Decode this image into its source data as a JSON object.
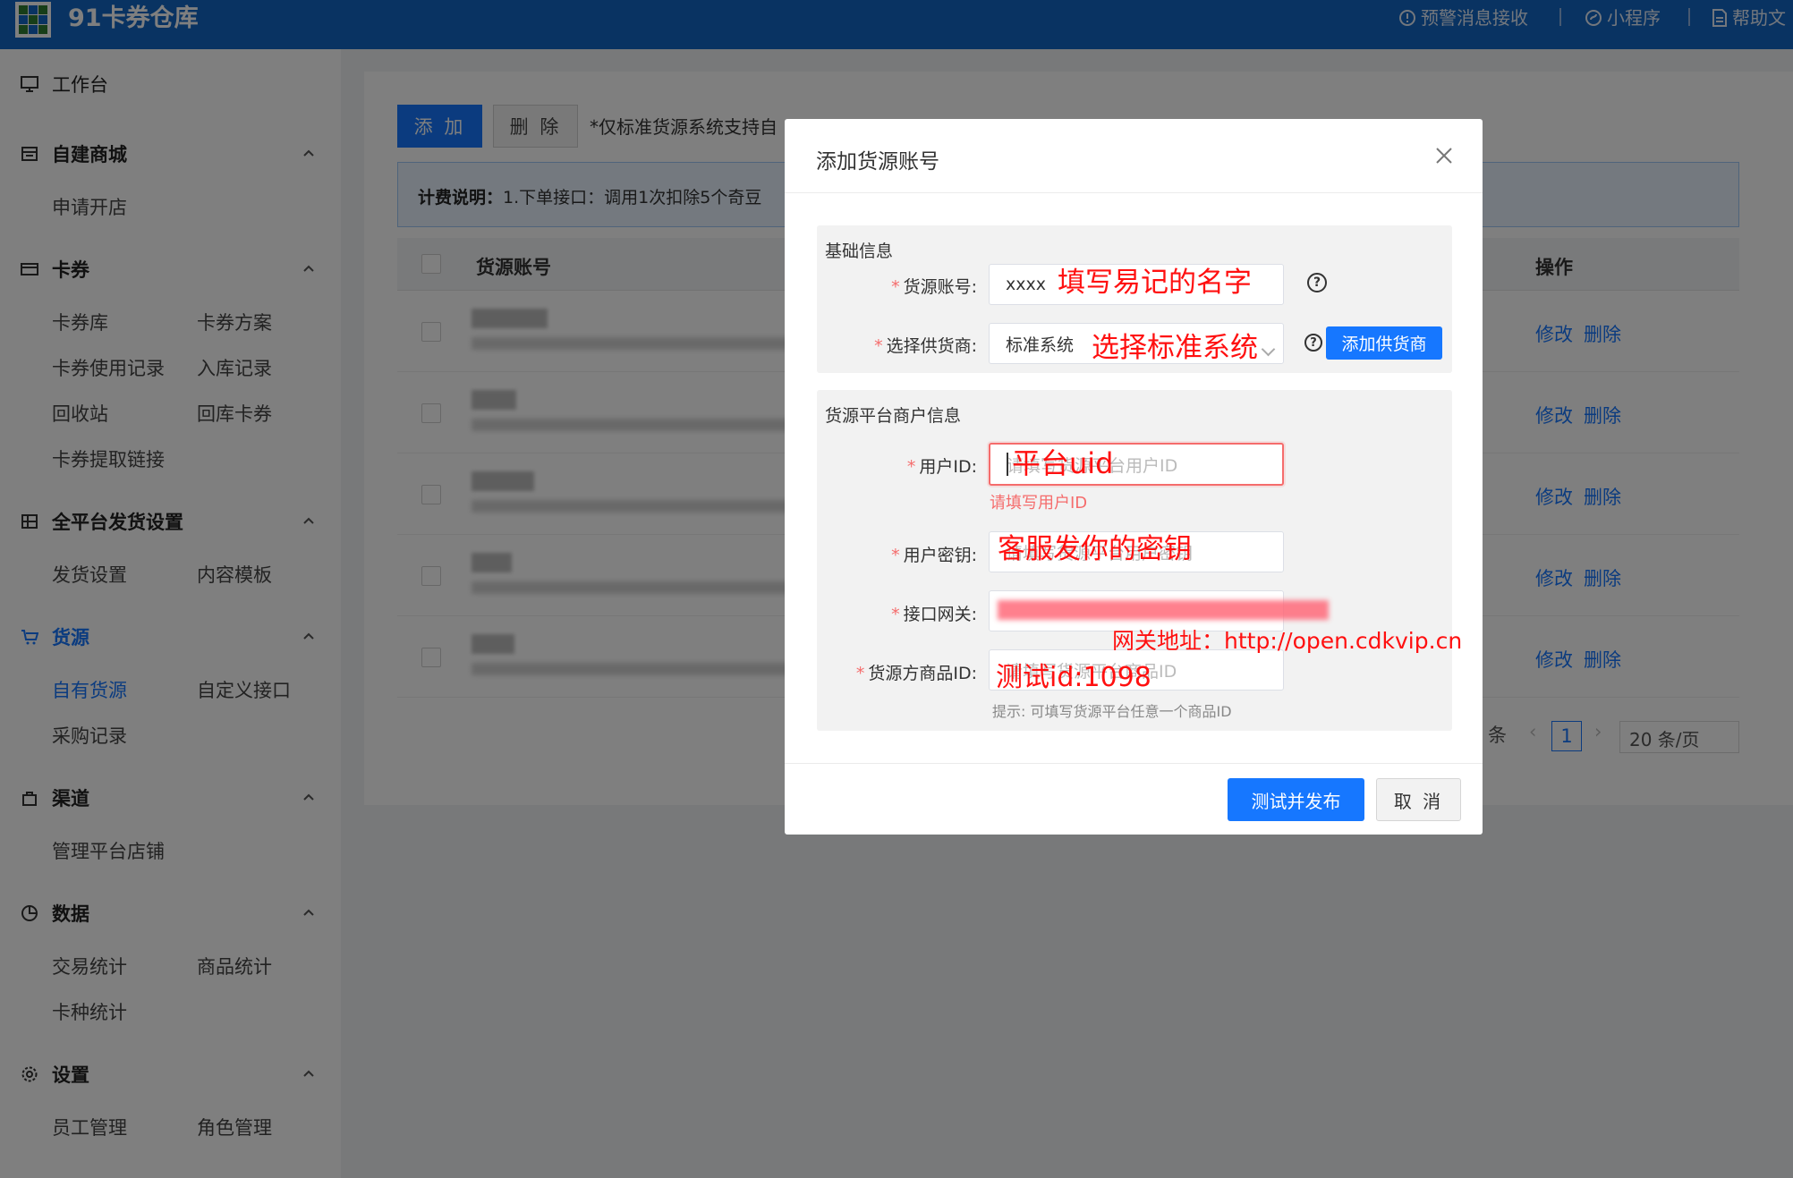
{
  "header": {
    "app_title": "91卡券仓库",
    "links": [
      {
        "icon": "alert-icon",
        "label": "预警消息接收"
      },
      {
        "icon": "miniprogram-icon",
        "label": "小程序"
      },
      {
        "icon": "document-icon",
        "label": "帮助文"
      }
    ]
  },
  "sidebar": {
    "workbench": "工作台",
    "sections": [
      {
        "icon": "store-icon",
        "label": "自建商城",
        "items": [
          "申请开店"
        ]
      },
      {
        "icon": "card-icon",
        "label": "卡券",
        "items": [
          "卡券库",
          "卡券方案",
          "卡券使用记录",
          "入库记录",
          "回收站",
          "回库卡券",
          "卡券提取链接"
        ]
      },
      {
        "icon": "grid-icon",
        "label": "全平台发货设置",
        "items": [
          "发货设置",
          "内容模板"
        ]
      },
      {
        "icon": "cart-icon",
        "label": "货源",
        "items": [
          "自有货源",
          "自定义接口",
          "采购记录"
        ]
      },
      {
        "icon": "bag-icon",
        "label": "渠道",
        "items": [
          "管理平台店铺"
        ]
      },
      {
        "icon": "pie-icon",
        "label": "数据",
        "items": [
          "交易统计",
          "商品统计",
          "卡种统计"
        ]
      },
      {
        "icon": "gear-icon",
        "label": "设置",
        "items": [
          "员工管理",
          "角色管理"
        ]
      }
    ]
  },
  "toolbar": {
    "add_label": "添 加",
    "delete_label": "删 除",
    "note": "*仅标准货源系统支持自"
  },
  "billing": {
    "label": "计费说明：",
    "text": "1.下单接口：调用1次扣除5个奇豆"
  },
  "table": {
    "columns": [
      "货源账号",
      "操作"
    ],
    "row_actions": [
      "修改",
      "删除"
    ],
    "row_count": 5
  },
  "pagination": {
    "total_suffix": "条",
    "current_page": "1",
    "page_size": "20 条/页"
  },
  "modal": {
    "title": "添加货源账号",
    "group1_title": "基础信息",
    "group2_title": "货源平台商户信息",
    "fields": {
      "account": {
        "label": "货源账号:",
        "value": "xxxx"
      },
      "supplier": {
        "label": "选择供货商:",
        "value": "标准系统"
      },
      "user_id": {
        "label": "用户ID:",
        "placeholder": "请填写货源平台用户ID"
      },
      "user_key": {
        "label": "用户密钥:",
        "placeholder": "请填写货源平台用户密钥"
      },
      "gateway": {
        "label": "接口网关:"
      },
      "product_id": {
        "label": "货源方商品ID:",
        "placeholder": "请填写货源平台商品ID"
      }
    },
    "add_supplier_label": "添加供货商",
    "user_id_error": "请填写用户ID",
    "product_id_hint": "提示: 可填写货源平台任意一个商品ID",
    "submit_label": "测试并发布",
    "cancel_label": "取 消"
  },
  "annotations": {
    "account": "填写易记的名字",
    "supplier": "选择标准系统",
    "user_id": "平台uid",
    "user_key": "客服发你的密钥",
    "gateway": "网关地址：http://open.cdkvip.cn",
    "product_id": "测试id:1098"
  }
}
